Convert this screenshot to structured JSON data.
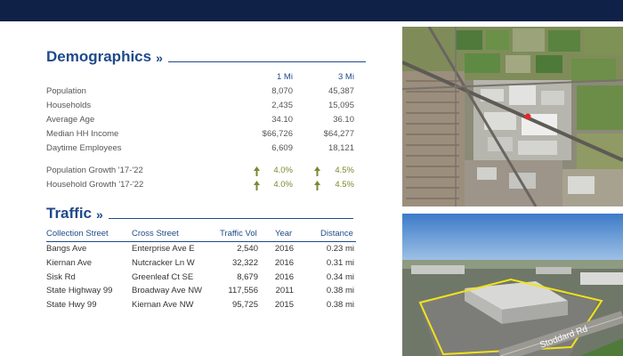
{
  "demographics": {
    "title": "Demographics",
    "chevron": "»",
    "col1": "1 Mi",
    "col2": "3 Mi",
    "rows": [
      {
        "label": "Population",
        "v1": "8,070",
        "v2": "45,387"
      },
      {
        "label": "Households",
        "v1": "2,435",
        "v2": "15,095"
      },
      {
        "label": "Average Age",
        "v1": "34.10",
        "v2": "36.10"
      },
      {
        "label": "Median HH Income",
        "v1": "$66,726",
        "v2": "$64,277"
      },
      {
        "label": "Daytime Employees",
        "v1": "6,609",
        "v2": "18,121"
      }
    ],
    "growth": [
      {
        "label": "Population Growth '17-'22",
        "v1": "4.0%",
        "v2": "4.5%"
      },
      {
        "label": "Household Growth '17-'22",
        "v1": "4.0%",
        "v2": "4.5%"
      }
    ],
    "growth_color": "#7a8a2e"
  },
  "traffic": {
    "title": "Traffic",
    "chevron": "»",
    "headers": [
      "Collection Street",
      "Cross Street",
      "Traffic Vol",
      "Year",
      "Distance"
    ],
    "rows": [
      [
        "Bangs Ave",
        "Enterprise Ave E",
        "2,540",
        "2016",
        "0.23 mi"
      ],
      [
        "Kiernan Ave",
        "Nutcracker Ln W",
        "32,322",
        "2016",
        "0.31 mi"
      ],
      [
        "Sisk Rd",
        "Greenleaf Ct SE",
        "8,679",
        "2016",
        "0.34 mi"
      ],
      [
        "State Highway 99",
        "Broadway Ave NW",
        "117,556",
        "2011",
        "0.38 mi"
      ],
      [
        "State Hwy 99",
        "Kiernan Ave NW",
        "95,725",
        "2015",
        "0.38 mi"
      ]
    ]
  },
  "photos": {
    "road_label": "Stoddard Rd"
  },
  "colors": {
    "brand_navy": "#0f2147",
    "heading_blue": "#1f4a8a",
    "outline_yellow": "#f2e21a"
  }
}
